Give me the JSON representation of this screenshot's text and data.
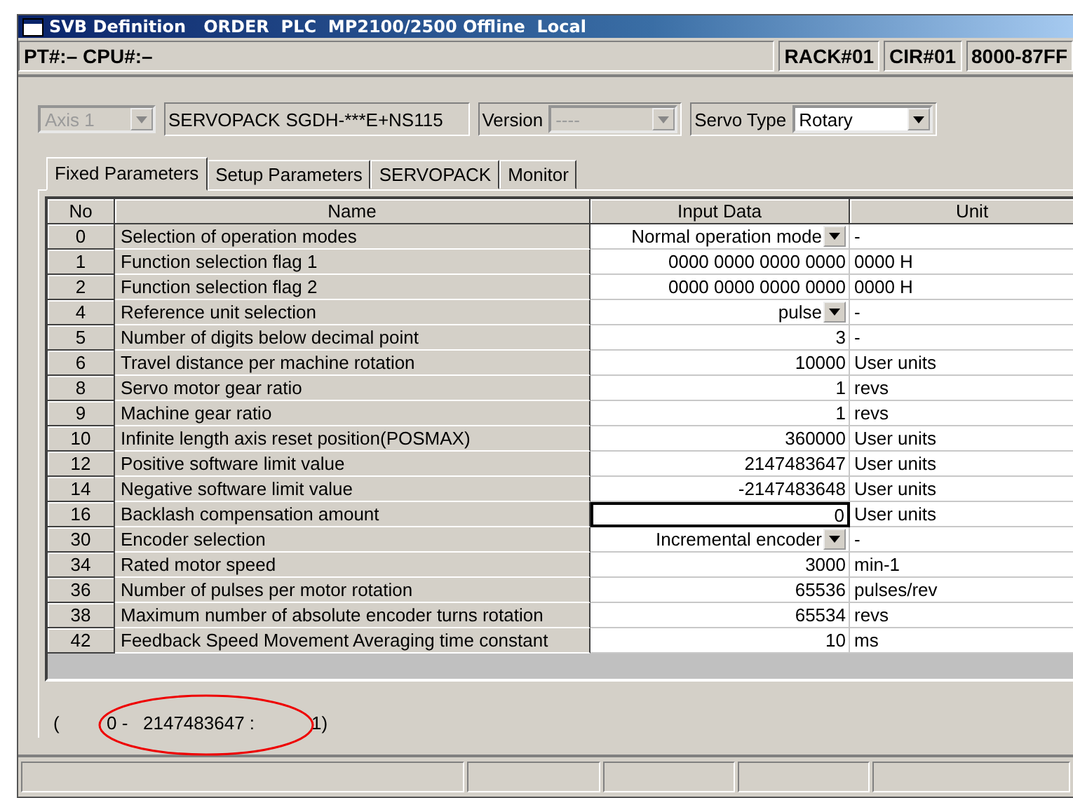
{
  "window": {
    "title": "SVB Definition   ORDER  PLC  MP2100/2500 Offline  Local"
  },
  "info_bar": {
    "location": "PT#:– CPU#:–",
    "fields": [
      "RACK#01",
      "CIR#01",
      "8000-87FF"
    ]
  },
  "axis": {
    "value": "Axis 1",
    "disabled": true
  },
  "servopack": {
    "label": "SERVOPACK",
    "model": "SGDH-***E+NS115"
  },
  "version": {
    "label": "Version",
    "value": "----",
    "disabled": true
  },
  "servo_type": {
    "label": "Servo Type",
    "value": "Rotary",
    "disabled": false
  },
  "tabs": [
    {
      "label": "Fixed Parameters",
      "selected": true
    },
    {
      "label": "Setup Parameters",
      "selected": false
    },
    {
      "label": "SERVOPACK",
      "selected": false
    },
    {
      "label": "Monitor",
      "selected": false
    }
  ],
  "table": {
    "columns": [
      "No",
      "Name",
      "Input Data",
      "Unit"
    ],
    "rows": [
      {
        "no": "0",
        "name": "Selection of operation modes",
        "input": "Normal operation mode",
        "unit": "-",
        "kind": "dropdown",
        "editing": false
      },
      {
        "no": "1",
        "name": "Function selection flag 1",
        "input": "0000 0000 0000 0000",
        "unit": "0000 H",
        "kind": "text",
        "editing": false
      },
      {
        "no": "2",
        "name": "Function selection flag 2",
        "input": "0000 0000 0000 0000",
        "unit": "0000 H",
        "kind": "text",
        "editing": false
      },
      {
        "no": "4",
        "name": "Reference unit selection",
        "input": "pulse",
        "unit": "-",
        "kind": "dropdown",
        "editing": false
      },
      {
        "no": "5",
        "name": "Number of digits below decimal point",
        "input": "3",
        "unit": "-",
        "kind": "text",
        "editing": false
      },
      {
        "no": "6",
        "name": "Travel distance per machine rotation",
        "input": "10000",
        "unit": "User units",
        "kind": "text",
        "editing": false
      },
      {
        "no": "8",
        "name": "Servo motor gear ratio",
        "input": "1",
        "unit": "revs",
        "kind": "text",
        "editing": false
      },
      {
        "no": "9",
        "name": "Machine gear ratio",
        "input": "1",
        "unit": "revs",
        "kind": "text",
        "editing": false
      },
      {
        "no": "10",
        "name": "Infinite length axis reset position(POSMAX)",
        "input": "360000",
        "unit": "User units",
        "kind": "text",
        "editing": false
      },
      {
        "no": "12",
        "name": "Positive software limit value",
        "input": "2147483647",
        "unit": "User units",
        "kind": "text",
        "editing": false
      },
      {
        "no": "14",
        "name": "Negative software limit value",
        "input": "-2147483648",
        "unit": "User units",
        "kind": "text",
        "editing": false
      },
      {
        "no": "16",
        "name": "Backlash compensation amount",
        "input": "0",
        "unit": "User units",
        "kind": "text",
        "editing": true
      },
      {
        "no": "30",
        "name": "Encoder selection",
        "input": "Incremental encoder",
        "unit": "-",
        "kind": "dropdown",
        "editing": false
      },
      {
        "no": "34",
        "name": "Rated motor speed",
        "input": "3000",
        "unit": "min-1",
        "kind": "text",
        "editing": false
      },
      {
        "no": "36",
        "name": "Number of pulses per motor rotation",
        "input": "65536",
        "unit": "pulses/rev",
        "kind": "text",
        "editing": false
      },
      {
        "no": "38",
        "name": "Maximum number of absolute encoder turns rotation",
        "input": "65534",
        "unit": "revs",
        "kind": "text",
        "editing": false
      },
      {
        "no": "42",
        "name": "Feedback Speed Movement Averaging time constant",
        "input": "10",
        "unit": "ms",
        "kind": "text",
        "editing": false
      }
    ]
  },
  "range": {
    "open": "(",
    "min": "0 -",
    "max": "2147483647 :",
    "step": "1)"
  }
}
